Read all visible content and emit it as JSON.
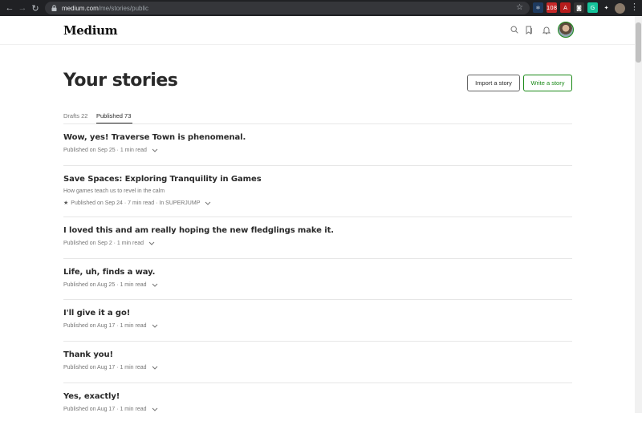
{
  "browser": {
    "url_host": "medium.com",
    "url_path": "/me/stories/public",
    "extensions": [
      {
        "name": "react-extension-icon",
        "glyph": "⚛",
        "color": "#1e3a5f"
      },
      {
        "name": "badge-extension-icon",
        "glyph": "108",
        "color": "#c62828"
      },
      {
        "name": "pdf-extension-icon",
        "glyph": "A",
        "color": "#b71c1c"
      },
      {
        "name": "camera-extension-icon",
        "glyph": "◙",
        "color": "#333"
      },
      {
        "name": "grammarly-extension-icon",
        "glyph": "G",
        "color": "#15c39a"
      },
      {
        "name": "puzzle-extension-icon",
        "glyph": "✦",
        "color": "#202124"
      },
      {
        "name": "playlist-extension-icon",
        "glyph": "≡",
        "color": "#202124"
      }
    ]
  },
  "header": {
    "logo": "Medium"
  },
  "page": {
    "title": "Your stories",
    "import_label": "Import a story",
    "write_label": "Write a story"
  },
  "tabs": {
    "drafts": "Drafts 22",
    "published": "Published 73"
  },
  "stories": [
    {
      "title": "Wow, yes! Traverse Town is phenomenal.",
      "subtitle": "",
      "meta": "Published on Sep 25 · 1 min read",
      "starred": false
    },
    {
      "title": "Save Spaces: Exploring Tranquility in Games",
      "subtitle": "How games teach us to revel in the calm",
      "meta": "Published on Sep 24 · 7 min read · In SUPERJUMP",
      "starred": true
    },
    {
      "title": "I loved this and am really hoping the new fledglings make it.",
      "subtitle": "",
      "meta": "Published on Sep 2 · 1 min read",
      "starred": false
    },
    {
      "title": "Life, uh, finds a way.",
      "subtitle": "",
      "meta": "Published on Aug 25 · 1 min read",
      "starred": false
    },
    {
      "title": "I'll give it a go!",
      "subtitle": "",
      "meta": "Published on Aug 17 · 1 min read",
      "starred": false
    },
    {
      "title": "Thank you!",
      "subtitle": "",
      "meta": "Published on Aug 17 · 1 min read",
      "starred": false
    },
    {
      "title": "Yes, exactly!",
      "subtitle": "",
      "meta": "Published on Aug 17 · 1 min read",
      "starred": false
    }
  ]
}
